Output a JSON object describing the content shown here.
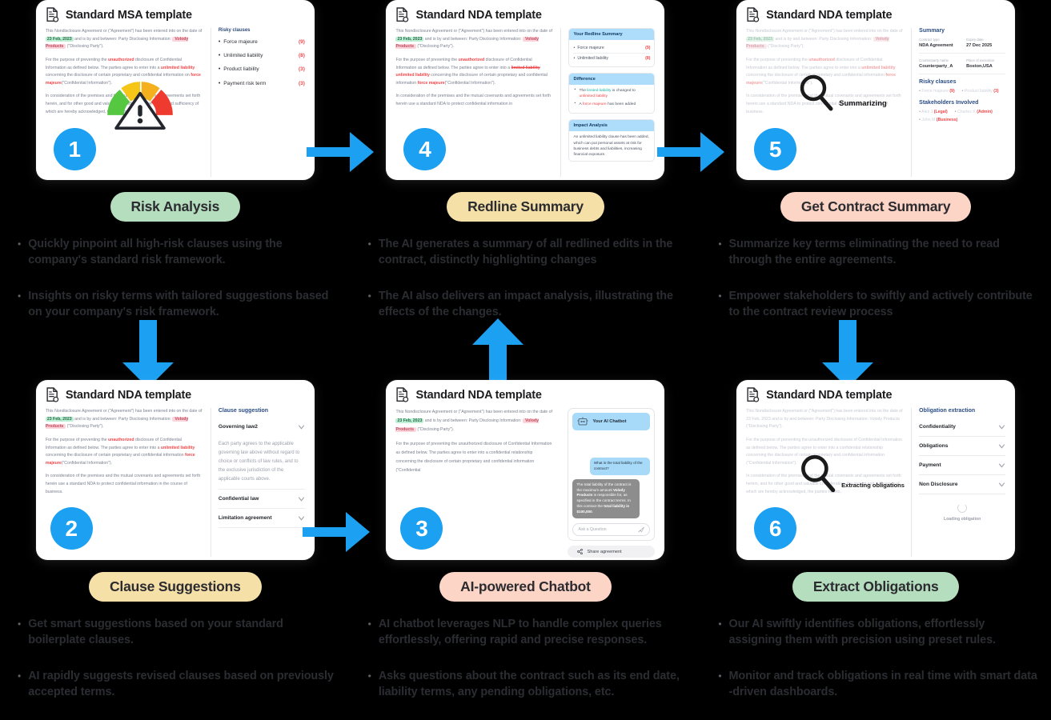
{
  "meta": {
    "accent_blue": "#1ba0f2",
    "background": "#000000",
    "text_color": "#2b2d32"
  },
  "cards": {
    "c1": {
      "title": "Standard MSA template",
      "badge": "1",
      "doc": {
        "p1_a": "This Nondisclosure Agreement or (\"Agreement\") has been entered into on the date of ",
        "p1_date": "23 Feb, 2023",
        "p1_b": " and is by and between: Party Disclosing Information: ",
        "p1_party": "Volody Products",
        "p1_c": " (\"Disclosing Party\").",
        "p2_a": "For the purpose of preventing the ",
        "p2_unauth": "unauthorized",
        "p2_b": " disclosure of Confidential Information as defined below. The parties agree to enter into a ",
        "p2_unl": "unlimited liability",
        "p2_c": " concerning the disclosure of certain proprietary and confidential information on ",
        "p2_force": "force majeure",
        "p2_d": "(\"Confidential Information\").",
        "p3": "In consideration of the premises and the mutual covenants and agreements set forth herein, and for other good and valuable consideration, the receipt and sufficiency of which are hereby acknowledged, the parties hereto,"
      },
      "side_title": "Risky clauses",
      "risky": [
        {
          "label": "Force majeure",
          "count": "(9)"
        },
        {
          "label": "Unlimited liability",
          "count": "(8)"
        },
        {
          "label": "Product liability",
          "count": "(3)"
        },
        {
          "label": "Payment risk term",
          "count": "(3)"
        }
      ],
      "overlay_icon": "risk-gauge-warning-icon"
    },
    "c4": {
      "title": "Standard NDA template",
      "badge": "4",
      "doc": {
        "p1_a": "This Nondisclosure Agreement or (\"Agreement\") has been entered into on the date of ",
        "p1_date": "23 Feb, 2023",
        "p1_b": " and is by and between: Party Disclosing Information: ",
        "p1_party": "Volody Products",
        "p1_c": " (\"Disclosing Party\").",
        "p2_a": "For the purpose of preventing the ",
        "p2_unauth": "unauthorized",
        "p2_b": " disclosure of Confidential Information as defined below. The parties agree to enter into a ",
        "p2_strike": "limited liability",
        "p2_new": "unlimited liability",
        "p2_c": " concerning the disclosure of certain proprietary and confidential information ",
        "p2_force": "force majeure",
        "p2_d": "(\"Confidential Information\").",
        "p3": "In consideration of the premises and the mutual covenants and agreements set forth herein use a standard NDA to protect confidential information in"
      },
      "redline": {
        "head": "Your Redline Summary",
        "rows": [
          {
            "label": "Force majeure",
            "count": "(9)"
          },
          {
            "label": "Unlimited liability",
            "count": "(8)"
          }
        ]
      },
      "difference": {
        "head": "Difference",
        "items": [
          {
            "pre": "The ",
            "green": "limited liability",
            "mid": " is changed to ",
            "red": "unlimited liability",
            "post": ""
          },
          {
            "pre": "A ",
            "green": "",
            "mid": "",
            "red": "force majeure",
            "post": " has been added"
          }
        ]
      },
      "impact": {
        "head": "Impact Analysis",
        "text": "An unlimited liability clause has been added, which can put personal assets at risk for business debts and liabilities, increasing financial exposure."
      }
    },
    "c5": {
      "title": "Standard NDA template",
      "badge": "5",
      "overlay_label": "Summarizing",
      "overlay_icon": "search-icon",
      "doc": {
        "p1_a": "This Nondisclosure Agreement or (\"Agreement\") has been entered into on the date of ",
        "p1_date": "23 Feb, 2023",
        "p1_b": " and is by and between: Party Disclosing Information: ",
        "p1_party": "Volody Products",
        "p1_c": " (\"Disclosing Party\").",
        "p2_a": "For the purpose of preventing the ",
        "p2_unauth": "unauthorized",
        "p2_b": " disclosure of Confidential Information as defined below. The parties agree to enter into a ",
        "p2_unl": "unlimited liability",
        "p2_c": " concerning the disclosure of certain proprietary and confidential information ",
        "p2_force": "force majeure",
        "p2_d": "(\"Confidential Information\").",
        "p3": "In consideration of the premises and the mutual covenants and agreements set forth herein use a standard NDA to protect confidential information in the course of business."
      },
      "summary": {
        "title": "Summary",
        "fields": [
          {
            "label": "Contract type",
            "value": "NDA Agreement"
          },
          {
            "label": "Expiry date",
            "value": "27 Dec 2025"
          },
          {
            "label": "Counterparty name",
            "value": "Counterparty_A"
          },
          {
            "label": "Place of execution",
            "value": "Boston,USA"
          }
        ]
      },
      "risky": {
        "title": "Risky clauses",
        "items": [
          {
            "label": "Force majeure",
            "count": "(9)"
          },
          {
            "label": "Product liability",
            "count": "(3)"
          }
        ]
      },
      "stakeholders": {
        "title": "Stakeholders Involved",
        "items": [
          {
            "name": "Alex J",
            "role": "(Legal)"
          },
          {
            "name": "Charles K",
            "role": "(Admin)"
          },
          {
            "name": "John M",
            "role": "(Business)"
          }
        ]
      }
    },
    "c2": {
      "title": "Standard NDA template",
      "badge": "2",
      "doc": {
        "p1_a": "This Nondisclosure Agreement or (\"Agreement\") has been entered into on the date of ",
        "p1_date": "23 Feb, 2023",
        "p1_b": " and is by and between: Party Disclosing Information: ",
        "p1_party": "Volody Products",
        "p1_c": " (\"Disclosing Party\").",
        "p2_a": "For the purpose of preventing the ",
        "p2_unauth": "unauthorized",
        "p2_b": " disclosure of Confidential Information as defined below. The parties agree to enter into a ",
        "p2_unl": "unlimited liability",
        "p2_c": " concerning the disclosure of certain proprietary and confidential information ",
        "p2_force": "force majeure",
        "p2_d": "(\"Confidential Information\").",
        "p3": "In consideration of the premises and the mutual covenants and agreements set forth herein use a standard NDA to protect confidential information in the course of business."
      },
      "clause": {
        "title": "Clause suggestion",
        "open_item": "Governing law2",
        "open_text": "Each party agrees to the applicable governing law above without regard to choice or conflicts of law rules, and to the exclusive jurisdiction of the applicable courts above.",
        "items": [
          "Confidential law",
          "Limitation agreement"
        ]
      }
    },
    "c3": {
      "title": "Standard NDA template",
      "badge": "3",
      "doc": {
        "p1_a": "This Nondisclosure Agreement or (\"Agreement\") has been entered into on the date of ",
        "p1_date": "23 Feb, 2023",
        "p1_b": " and is by and between: Party Disclosing Information: ",
        "p1_party": "Volody Products",
        "p1_c": " (\"Disclosing Party\").",
        "p2": "For the purpose of preventing the unauthorized disclosure of Confidential Information as defined below. The parties agree to enter into a confidential relationship concerning the disclosure of certain proprietary and confidential information (\"Confidential"
      },
      "chat": {
        "header": "Your AI Chatbot",
        "user_message": "What is the total liability of the contract?",
        "bot_message_a": "The total liability of the contract is the maximum amount ",
        "bot_message_party": "Volody Products",
        "bot_message_b": " is responsible for, as specified in the contract terms. In this contract the ",
        "bot_message_bold": "total liability is $100,000",
        "bot_message_c": ".",
        "input_placeholder": "Ask a Question",
        "share_label": "Share agreement"
      }
    },
    "c6": {
      "title": "Standard NDA template",
      "badge": "6",
      "overlay_label": "Extracting obligations",
      "overlay_icon": "search-icon",
      "doc": {
        "p1": "This Nondisclosure Agreement or (\"Agreement\") has been entered into on the date of 23 Feb, 2023  and is by and between: Party Disclosing Information:   Volody Products (\"Disclosing Party\").",
        "p2": "For the purpose of preventing the unauthorized disclosure of Confidential Information as defined below. The parties agree to enter into a confidential relationship concerning the disclosure of certain proprietary and confidential information (\"Confidential Information\").",
        "p3": "In consideration of the premises and the mutual covenants and agreements set forth herein, and for other good and valuable consideration, the receipt and sufficiency of which are hereby acknowledged, the parties hereto,"
      },
      "obligation": {
        "title": "Obligation extraction",
        "items": [
          "Confidentiality",
          "Obligations",
          "Payment",
          "Non Disclosure"
        ],
        "loading_label": "Loading obligation"
      }
    }
  },
  "features": [
    {
      "pill": "Risk Analysis",
      "pill_color": "#b5debe",
      "bullets": [
        "Quickly pinpoint all high-risk clauses using the company's standard risk framework.",
        "Insights on risky terms with tailored suggestions based on your company's risk framework."
      ]
    },
    {
      "pill": "Redline Summary",
      "pill_color": "#f5e0a8",
      "bullets": [
        "The AI generates a summary of all redlined edits in the contract, distinctly highlighting changes",
        "The AI also delivers an impact analysis, illustrating the effects of the changes."
      ]
    },
    {
      "pill": "Get Contract Summary",
      "pill_color": "#fcd5c6",
      "bullets": [
        "Summarize key terms eliminating the need to read through the entire agreements.",
        "Empower stakeholders to swiftly and actively contribute to the contract review process"
      ]
    },
    {
      "pill": "Clause Suggestions",
      "pill_color": "#f5e0a8",
      "bullets": [
        "Get smart suggestions based on your standard boilerplate clauses.",
        "AI rapidly suggests revised clauses based on previously accepted terms."
      ]
    },
    {
      "pill": "AI-powered Chatbot",
      "pill_color": "#fcd5c6",
      "bullets": [
        "AI chatbot leverages NLP to handle complex queries effortlessly, offering rapid and precise responses.",
        "Asks questions about the contract such as its end date, liability terms, any pending obligations, etc."
      ]
    },
    {
      "pill": "Extract Obligations",
      "pill_color": "#b5debe",
      "bullets": [
        "Our AI swiftly identifies obligations, effortlessly assigning them with precision using preset rules.",
        "Monitor and track obligations in real time with smart data -driven dashboards."
      ]
    }
  ],
  "arrows": [
    {
      "name": "arrow-right-1-to-4",
      "direction": "right"
    },
    {
      "name": "arrow-down-1-to-2",
      "direction": "down"
    },
    {
      "name": "arrow-up-3-to-4",
      "direction": "up"
    },
    {
      "name": "arrow-right-4-to-5",
      "direction": "right"
    },
    {
      "name": "arrow-right-2-to-3",
      "direction": "right"
    },
    {
      "name": "arrow-down-5-to-6",
      "direction": "down"
    }
  ]
}
